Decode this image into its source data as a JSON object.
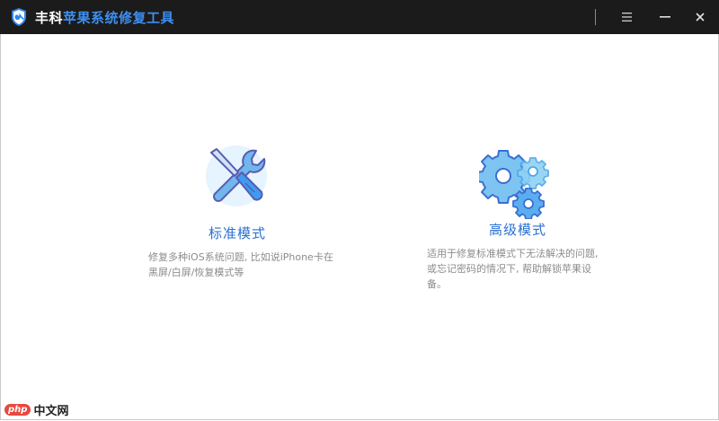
{
  "window": {
    "title_part1": "丰科",
    "title_part2": "苹果系统修复工具",
    "menu_glyph": "☰",
    "minimize_glyph": "—",
    "close_glyph": "✕"
  },
  "modes": [
    {
      "title": "标准模式",
      "desc_line1": "修复多种iOS系统问题, 比如说iPhone卡在",
      "desc_line2": "黑屏/白屏/恢复模式等"
    },
    {
      "title": "高级模式",
      "desc_line1": "适用于修复标准模式下无法解决的问题,",
      "desc_line2": "或忘记密码的情况下, 帮助解锁苹果设",
      "desc_line3": "备。"
    }
  ],
  "watermark": {
    "logo": "php",
    "text": "中文网"
  },
  "colors": {
    "titlebar": "#1b1b1b",
    "accent": "#3d8ff0",
    "mode_title": "#2a6fcf",
    "desc": "#8c8c8c"
  },
  "icons": {
    "logo": "shield-wrench-icon",
    "menu": "menu-icon",
    "minimize": "minimize-icon",
    "close": "close-icon",
    "standard": "wrench-screwdriver-icon",
    "advanced": "gears-icon"
  }
}
